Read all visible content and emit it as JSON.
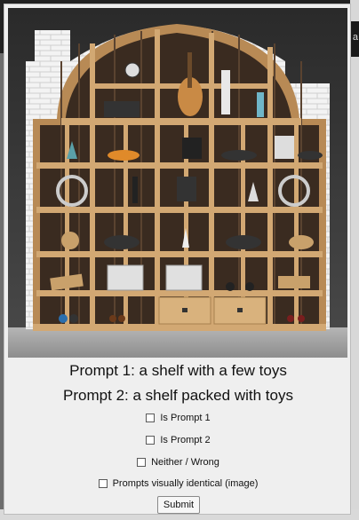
{
  "background": {
    "right_edge_letter": "a"
  },
  "image": {
    "subject": "arched wooden shelf with toys"
  },
  "prompts": {
    "prompt1": "Prompt 1: a shelf with a few toys",
    "prompt2": "Prompt 2: a shelf packed with toys"
  },
  "options": [
    {
      "label": "Is Prompt 1",
      "checked": false
    },
    {
      "label": "Is Prompt 2",
      "checked": false
    },
    {
      "label": "Neither / Wrong",
      "checked": false
    },
    {
      "label": "Prompts visually identical (image)",
      "checked": false
    }
  ],
  "submit_label": "Submit",
  "colors": {
    "dialog_bg": "#efefef",
    "wood": "#c9a16b",
    "brick": "#f2f2f2"
  }
}
